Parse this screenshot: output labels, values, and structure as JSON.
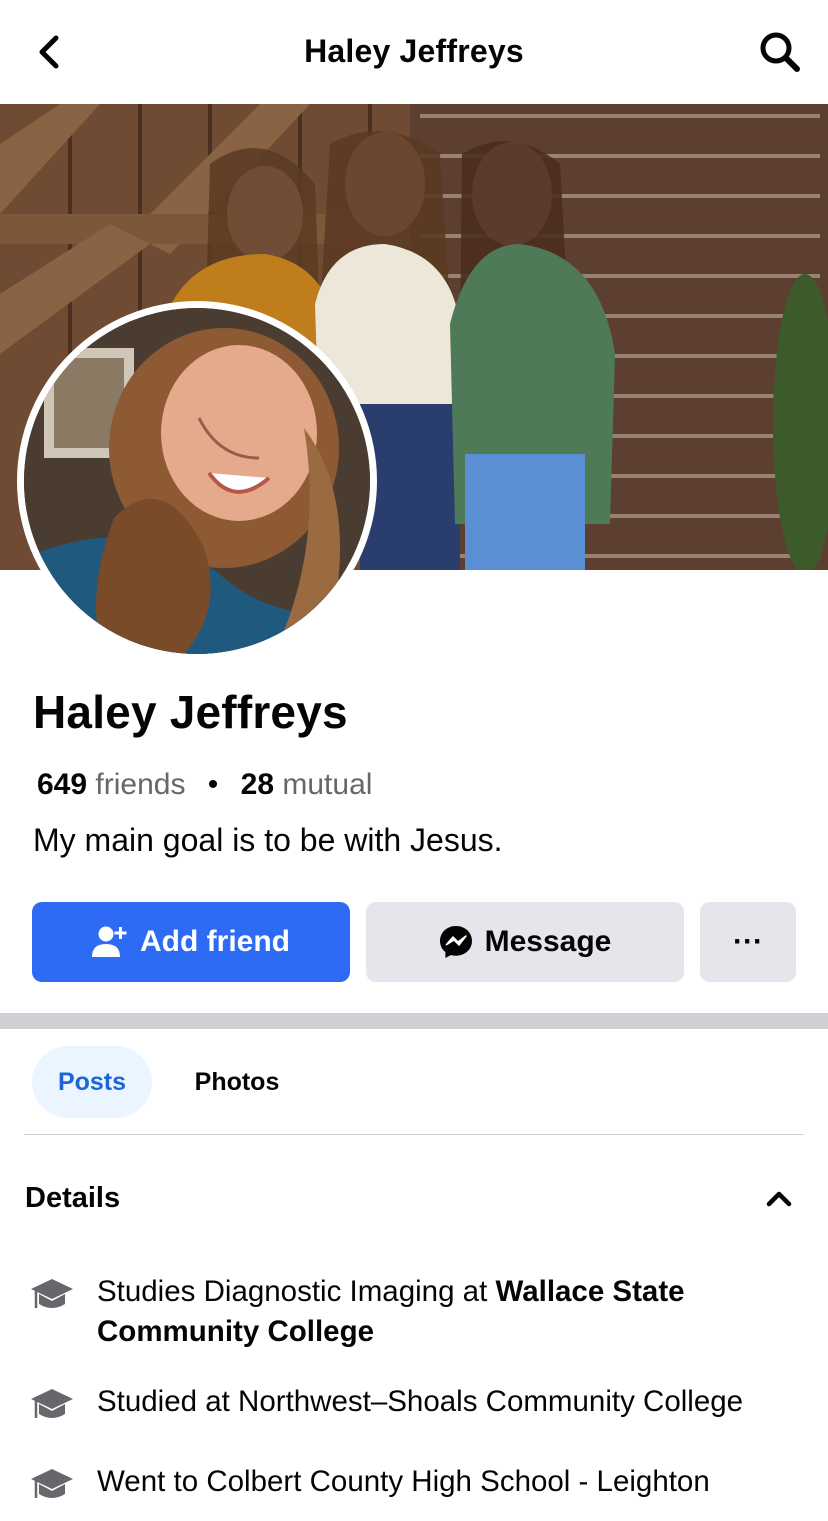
{
  "header": {
    "title": "Haley Jeffreys",
    "back_icon": "chevron-left-icon",
    "search_icon": "search-icon"
  },
  "profile": {
    "name": "Haley Jeffreys",
    "friends_count": "649",
    "friends_label": "friends",
    "mutual_count": "28",
    "mutual_label": "mutual",
    "bio": "My main goal is to be with Jesus."
  },
  "actions": {
    "add_friend": "Add friend",
    "message": "Message",
    "more": "···"
  },
  "tabs": [
    {
      "label": "Posts",
      "active": true
    },
    {
      "label": "Photos",
      "active": false
    }
  ],
  "details": {
    "title": "Details",
    "items": [
      {
        "icon": "graduation-cap-icon",
        "prefix": "Studies Diagnostic Imaging at ",
        "bold": "Wallace State Community College"
      },
      {
        "icon": "graduation-cap-icon",
        "prefix": "Studied at Northwest–Shoals Community College",
        "bold": ""
      },
      {
        "icon": "graduation-cap-icon",
        "prefix": "Went to Colbert County High School - Leighton",
        "bold": ""
      }
    ]
  },
  "colors": {
    "primary": "#2d6bf5",
    "secondary_button": "#e4e6eb",
    "active_tab_bg": "#ebf5ff",
    "active_tab_text": "#1b66d8",
    "muted_text": "#65676b"
  }
}
